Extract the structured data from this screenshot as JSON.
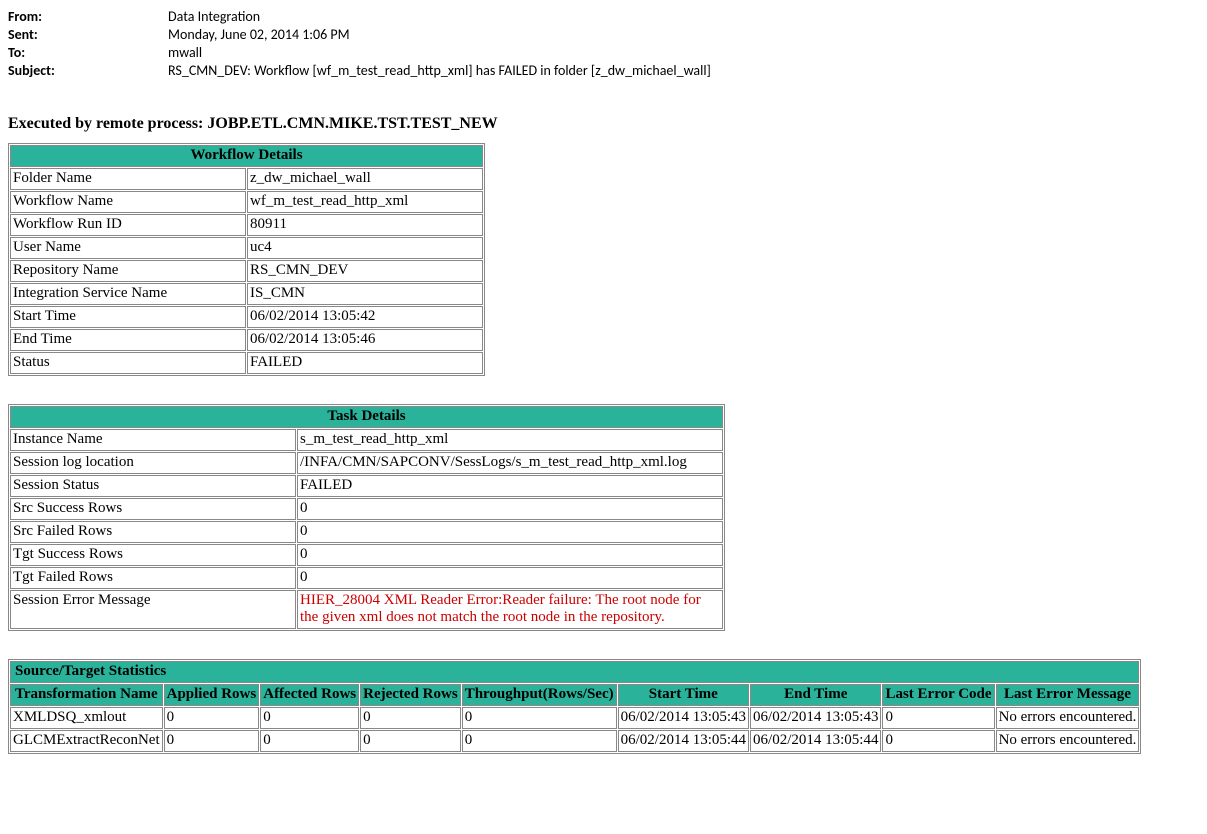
{
  "header": {
    "from_label": "From:",
    "from_value": "Data Integration",
    "sent_label": "Sent:",
    "sent_value": "Monday, June 02, 2014 1:06 PM",
    "to_label": "To:",
    "to_value": "mwall",
    "subject_label": "Subject:",
    "subject_value": "RS_CMN_DEV:  Workflow [wf_m_test_read_http_xml] has FAILED in folder [z_dw_michael_wall]"
  },
  "executed": "Executed by remote process: JOBP.ETL.CMN.MIKE.TST.TEST_NEW",
  "workflow": {
    "title": "Workflow Details",
    "rows": [
      {
        "label": "Folder Name",
        "value": "z_dw_michael_wall"
      },
      {
        "label": "Workflow Name",
        "value": "wf_m_test_read_http_xml"
      },
      {
        "label": "Workflow Run ID",
        "value": "80911"
      },
      {
        "label": "User Name",
        "value": "uc4"
      },
      {
        "label": "Repository Name",
        "value": "RS_CMN_DEV"
      },
      {
        "label": "Integration Service Name",
        "value": "IS_CMN"
      },
      {
        "label": "Start Time",
        "value": "06/02/2014 13:05:42"
      },
      {
        "label": "End Time",
        "value": "06/02/2014 13:05:46"
      },
      {
        "label": "Status",
        "value": "FAILED"
      }
    ]
  },
  "task": {
    "title": "Task Details",
    "rows": [
      {
        "label": "Instance Name",
        "value": "s_m_test_read_http_xml"
      },
      {
        "label": "Session log location",
        "value": "/INFA/CMN/SAPCONV/SessLogs/s_m_test_read_http_xml.log"
      },
      {
        "label": "Session Status",
        "value": "FAILED"
      },
      {
        "label": "Src Success Rows",
        "value": "0"
      },
      {
        "label": "Src Failed Rows",
        "value": "0"
      },
      {
        "label": "Tgt Success Rows",
        "value": "0"
      },
      {
        "label": "Tgt Failed Rows",
        "value": "0"
      },
      {
        "label": "Session Error Message",
        "value": "HIER_28004 XML Reader Error:Reader failure: The root node for the given xml does not match the root node in the repository.",
        "error": true
      }
    ]
  },
  "stats": {
    "title": "Source/Target Statistics",
    "headers": [
      "Transformation Name",
      "Applied Rows",
      "Affected Rows",
      "Rejected Rows",
      "Throughput(Rows/Sec)",
      "Start Time",
      "End Time",
      "Last Error Code",
      "Last Error Message"
    ],
    "rows": [
      [
        "XMLDSQ_xmlout",
        "0",
        "0",
        "0",
        "0",
        "06/02/2014 13:05:43",
        "06/02/2014 13:05:43",
        "0",
        "No errors encountered."
      ],
      [
        "GLCMExtractReconNet",
        "0",
        "0",
        "0",
        "0",
        "06/02/2014 13:05:44",
        "06/02/2014 13:05:44",
        "0",
        "No errors encountered."
      ]
    ]
  }
}
